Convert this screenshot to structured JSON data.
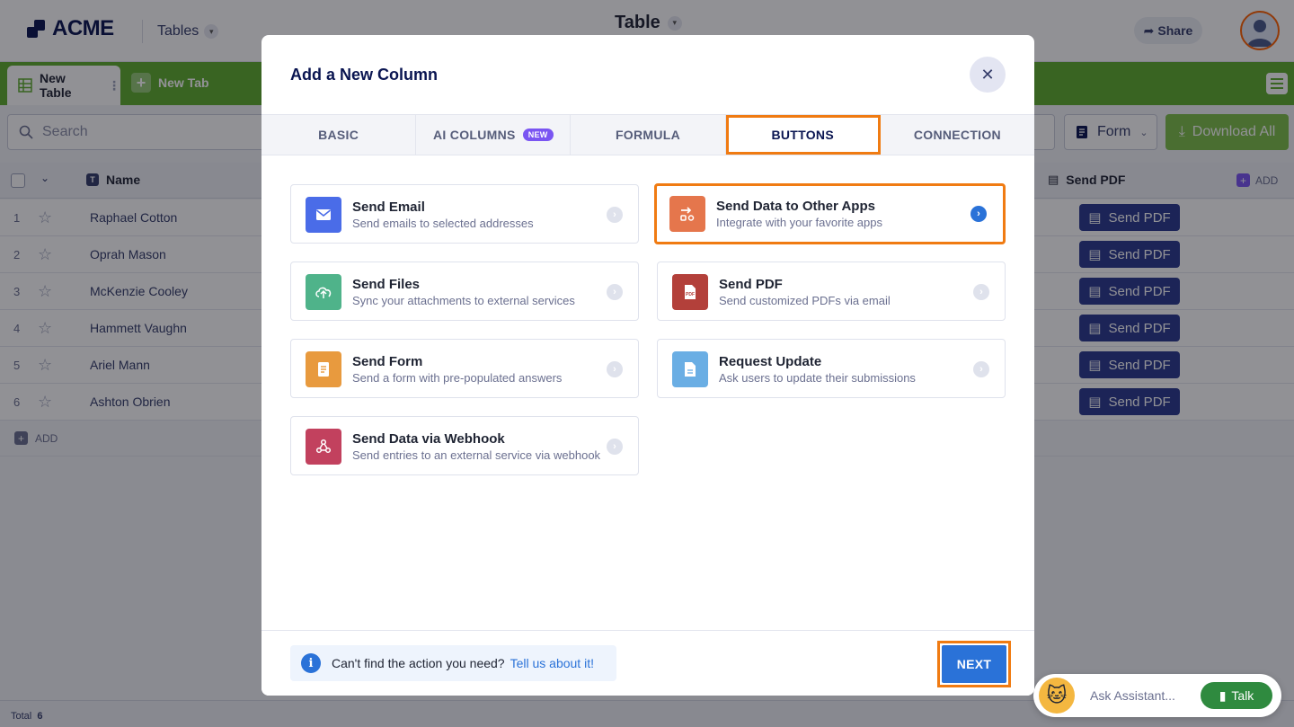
{
  "app": {
    "logo_text": "ACME",
    "tables_menu": "Tables",
    "page_title": "Table",
    "share_label": "Share"
  },
  "tabs_bar": {
    "active_tab": "New Table",
    "new_tab": "New Tab"
  },
  "toolbar": {
    "search_placeholder": "Search",
    "form_label": "Form",
    "download_label": "Download All"
  },
  "grid": {
    "name_header": "Name",
    "pdf_header": "Send PDF",
    "add_column_label": "ADD",
    "add_row_label": "ADD",
    "pdf_button_label": "Send PDF",
    "rows": [
      {
        "num": "1",
        "name": "Raphael Cotton"
      },
      {
        "num": "2",
        "name": "Oprah Mason"
      },
      {
        "num": "3",
        "name": "McKenzie Cooley"
      },
      {
        "num": "4",
        "name": "Hammett Vaughn"
      },
      {
        "num": "5",
        "name": "Ariel Mann"
      },
      {
        "num": "6",
        "name": "Ashton Obrien"
      }
    ],
    "total_label": "Total",
    "total_count": "6"
  },
  "assistant": {
    "ask_label": "Ask Assistant...",
    "talk_label": "Talk"
  },
  "modal": {
    "title": "Add a New Column",
    "tabs": [
      {
        "label": "BASIC",
        "active": false
      },
      {
        "label": "AI COLUMNS",
        "badge": "NEW",
        "active": false
      },
      {
        "label": "FORMULA",
        "active": false
      },
      {
        "label": "BUTTONS",
        "active": true
      },
      {
        "label": "CONNECTION",
        "active": false
      }
    ],
    "cards": [
      {
        "id": "send-email",
        "title": "Send Email",
        "subtitle": "Send emails to selected addresses",
        "color": "#4a6ce8",
        "icon": "mail-icon"
      },
      {
        "id": "send-data-other-apps",
        "title": "Send Data to Other Apps",
        "subtitle": "Integrate with your favorite apps",
        "color": "#e5764c",
        "icon": "integration-icon",
        "selected": true
      },
      {
        "id": "send-files",
        "title": "Send Files",
        "subtitle": "Sync your attachments to external services",
        "color": "#4fb38a",
        "icon": "cloud-upload-icon"
      },
      {
        "id": "send-pdf",
        "title": "Send PDF",
        "subtitle": "Send customized PDFs via email",
        "color": "#b3403a",
        "icon": "pdf-icon"
      },
      {
        "id": "send-form",
        "title": "Send Form",
        "subtitle": "Send a form with pre-populated answers",
        "color": "#e89a3e",
        "icon": "form-icon"
      },
      {
        "id": "request-update",
        "title": "Request Update",
        "subtitle": "Ask users to update their submissions",
        "color": "#6aaee4",
        "icon": "document-icon"
      },
      {
        "id": "send-webhook",
        "title": "Send Data via Webhook",
        "subtitle": "Send entries to an external service via webhook",
        "color": "#c2415e",
        "icon": "webhook-icon"
      }
    ],
    "help_text": "Can't find the action you need?",
    "help_link": "Tell us about it!",
    "next_label": "NEXT"
  },
  "colors": {
    "accent_blue": "#2a72d8",
    "highlight_orange": "#f07b12",
    "tab_bar_green": "#5fae2e",
    "pdf_button": "#2b3a8f"
  }
}
